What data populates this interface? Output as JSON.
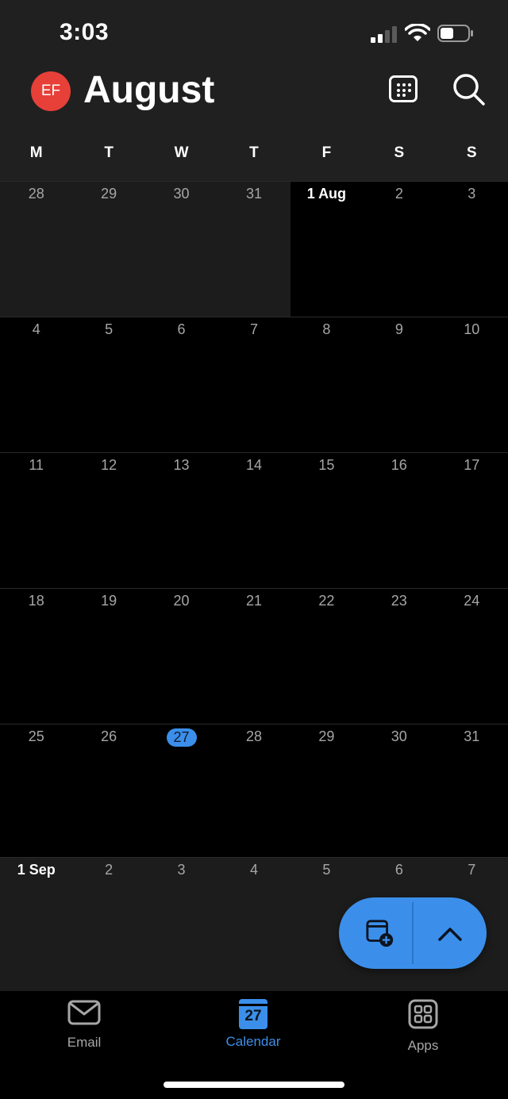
{
  "status_bar": {
    "time": "3:03"
  },
  "header": {
    "avatar_initials": "EF",
    "month": "August"
  },
  "weekdays": [
    "M",
    "T",
    "W",
    "T",
    "F",
    "S",
    "S"
  ],
  "weeks": [
    [
      "28",
      "29",
      "30",
      "31",
      "1 Aug",
      "2",
      "3"
    ],
    [
      "4",
      "5",
      "6",
      "7",
      "8",
      "9",
      "10"
    ],
    [
      "11",
      "12",
      "13",
      "14",
      "15",
      "16",
      "17"
    ],
    [
      "18",
      "19",
      "20",
      "21",
      "22",
      "23",
      "24"
    ],
    [
      "25",
      "26",
      "27",
      "28",
      "29",
      "30",
      "31"
    ]
  ],
  "next_week": [
    "1 Sep",
    "2",
    "3",
    "4",
    "5",
    "6",
    "7"
  ],
  "today": "27",
  "tabs": [
    {
      "label": "Email",
      "icon": "mail-icon"
    },
    {
      "label": "Calendar",
      "icon": "calendar-icon",
      "badge": "27",
      "active": true
    },
    {
      "label": "Apps",
      "icon": "apps-grid-icon"
    }
  ],
  "colors": {
    "accent": "#3b8fea",
    "avatar": "#e74038"
  }
}
